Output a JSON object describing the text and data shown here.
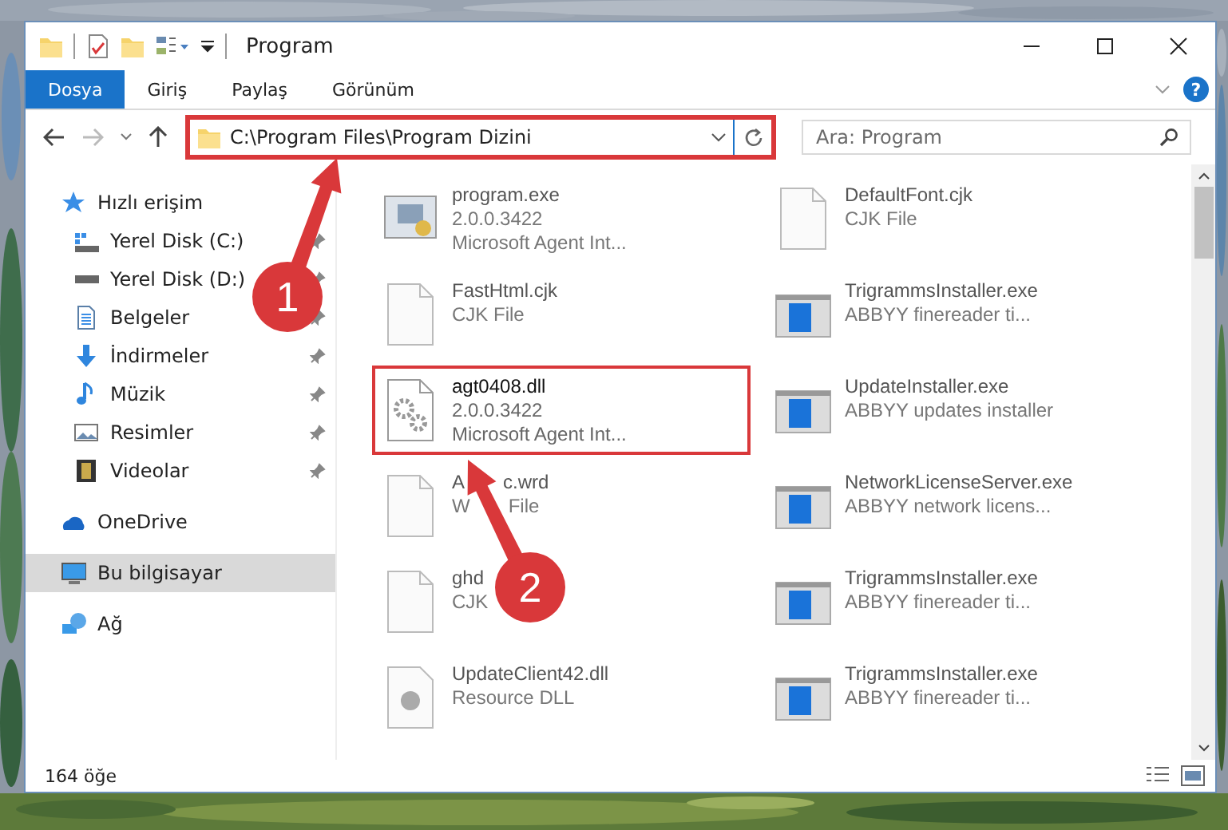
{
  "window": {
    "title": "Program"
  },
  "ribbon_tabs": [
    {
      "label": "Dosya",
      "selected": true
    },
    {
      "label": "Giriş",
      "selected": false
    },
    {
      "label": "Paylaş",
      "selected": false
    },
    {
      "label": "Görünüm",
      "selected": false
    }
  ],
  "help_button": "?",
  "address": {
    "path": "C:\\Program Files\\Program Dizini",
    "highlighted": true
  },
  "search": {
    "placeholder": "Ara: Program"
  },
  "sidebar": {
    "items": [
      {
        "label": "Hızlı erişim",
        "kind": "star",
        "selected": false,
        "children": [
          {
            "label": "Yerel Disk (C:)",
            "kind": "drive-win",
            "pinned": true,
            "selected": false
          },
          {
            "label": "Yerel Disk (D:)",
            "kind": "drive",
            "pinned": true,
            "selected": false
          },
          {
            "label": "Belgeler",
            "kind": "document",
            "pinned": true,
            "selected": false
          },
          {
            "label": "İndirmeler",
            "kind": "download",
            "pinned": true,
            "selected": false
          },
          {
            "label": "Müzik",
            "kind": "music",
            "pinned": true,
            "selected": false
          },
          {
            "label": "Resimler",
            "kind": "pictures",
            "pinned": true,
            "selected": false
          },
          {
            "label": "Videolar",
            "kind": "video",
            "pinned": true,
            "selected": false
          }
        ]
      },
      {
        "label": "OneDrive",
        "kind": "cloud",
        "selected": false
      },
      {
        "label": "Bu bilgisayar",
        "kind": "computer",
        "selected": true
      },
      {
        "label": "Ağ",
        "kind": "network",
        "selected": false
      }
    ]
  },
  "files": [
    {
      "name": "program.exe",
      "details": [
        "2.0.0.3422",
        "Microsoft Agent Int..."
      ],
      "kind": "exe",
      "highlighted": false
    },
    {
      "name": "DefaultFont.cjk",
      "details": [
        "CJK File"
      ],
      "kind": "generic",
      "highlighted": false
    },
    {
      "name": "FastHtml.cjk",
      "details": [
        "CJK File"
      ],
      "kind": "generic",
      "highlighted": false
    },
    {
      "name": "TrigrammsInstaller.exe",
      "details": [
        "ABBYY finereader ti..."
      ],
      "kind": "app",
      "highlighted": false
    },
    {
      "name": "agt0408.dll",
      "details": [
        "2.0.0.3422",
        "Microsoft Agent Int..."
      ],
      "kind": "gear",
      "highlighted": true
    },
    {
      "name": "UpdateInstaller.exe",
      "details": [
        "ABBYY updates installer"
      ],
      "kind": "app",
      "highlighted": false
    },
    {
      "name": [
        "A",
        "c.wrd"
      ],
      "details": [
        [
          "W",
          "File"
        ]
      ],
      "kind": "generic",
      "highlighted": false
    },
    {
      "name": "NetworkLicenseServer.exe",
      "details": [
        "ABBYY network licens..."
      ],
      "kind": "app",
      "highlighted": false
    },
    {
      "name": "ghd",
      "details": [
        "CJK"
      ],
      "kind": "generic",
      "highlighted": false
    },
    {
      "name": "TrigrammsInstaller.exe",
      "details": [
        "ABBYY finereader ti..."
      ],
      "kind": "app",
      "highlighted": false
    },
    {
      "name": "UpdateClient42.dll",
      "details": [
        "Resource DLL"
      ],
      "kind": "dll",
      "highlighted": false
    },
    {
      "name": "TrigrammsInstaller.exe",
      "details": [
        "ABBYY finereader ti..."
      ],
      "kind": "app",
      "highlighted": false
    }
  ],
  "status_bar": {
    "count": "164 öğe"
  },
  "annotations": [
    {
      "label": "1"
    },
    {
      "label": "2"
    }
  ]
}
